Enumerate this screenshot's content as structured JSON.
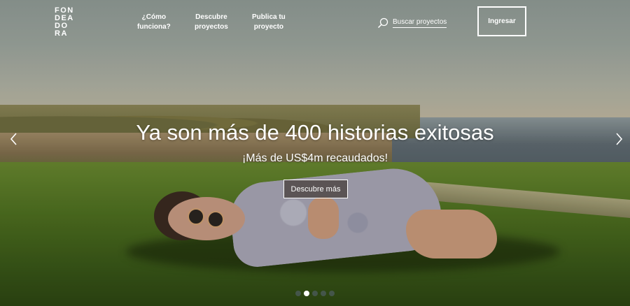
{
  "header": {
    "logo_lines": [
      "FON",
      "DEA",
      "DO",
      "RA"
    ],
    "nav": [
      {
        "line1": "¿Cómo",
        "line2": "funciona?"
      },
      {
        "line1": "Descubre",
        "line2": "proyectos"
      },
      {
        "line1": "Publica tu",
        "line2": "proyecto"
      }
    ],
    "search_label": "Buscar proyectos",
    "login_label": "Ingresar"
  },
  "hero": {
    "headline": "Ya son más de 400 historias exitosas",
    "subline": "¡Más de US$4m recaudados!",
    "cta_label": "Descubre más",
    "slides_total": 5,
    "active_slide": 2
  },
  "icons": {
    "search": "search-icon",
    "prev": "chevron-left-icon",
    "next": "chevron-right-icon"
  }
}
